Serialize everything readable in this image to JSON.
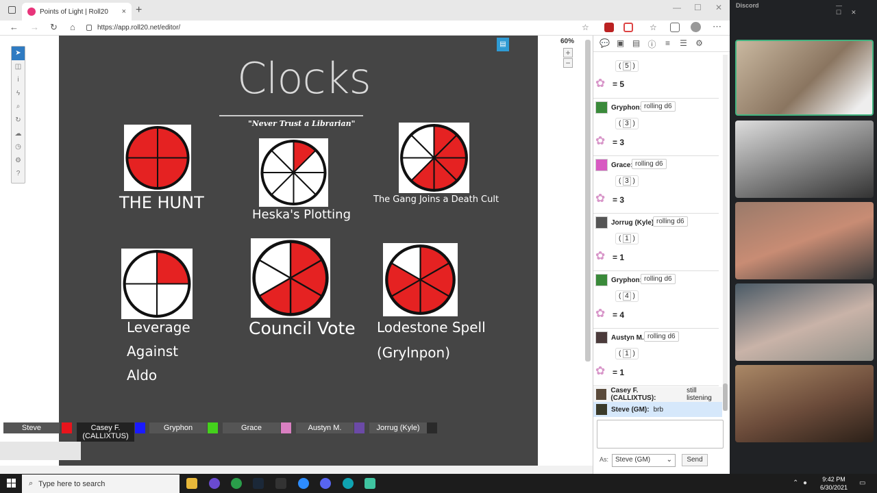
{
  "browser": {
    "tab_title": "Points of Light | Roll20",
    "url": "https://app.roll20.net/editor/",
    "new_tab": "+",
    "tab_close": "×"
  },
  "editor": {
    "zoom": "60%",
    "zoom_in": "+",
    "zoom_out": "−"
  },
  "board": {
    "title": "Clocks",
    "subtitle": "\"Never Trust a Librarian\"",
    "clocks": [
      {
        "label": "THE HUNT",
        "segments": 4,
        "filled": 4
      },
      {
        "label": "Heska's Plotting",
        "segments": 8,
        "filled": 1
      },
      {
        "label": "The Gang Joins a Death Cult",
        "segments": 8,
        "filled": 5
      },
      {
        "label": "Leverage Against Aldo",
        "segments": 4,
        "filled": 1
      },
      {
        "label": "Council Vote",
        "segments": 6,
        "filled": 4
      },
      {
        "label": "Lodestone Spell (Grylnpon)",
        "segments": 6,
        "filled": 5
      }
    ],
    "leverage_lines": [
      "Leverage",
      "Against",
      "Aldo"
    ],
    "lodestone_lines": [
      "Lodestone Spell",
      "(Grylnpon)"
    ]
  },
  "players": [
    {
      "name": "Steve",
      "color": "#e8141c"
    },
    {
      "name": "Casey F. (CALLIXTUS)",
      "color": "#1a1aff"
    },
    {
      "name": "Gryphon",
      "color": "#44d11c"
    },
    {
      "name": "Grace",
      "color": "#d97fc1"
    },
    {
      "name": "Austyn M.",
      "color": "#6b4aa6"
    },
    {
      "name": "Jorrug (Kyle)",
      "color": "#2a2a2a"
    }
  ],
  "chat": {
    "top_roll": {
      "die": "5",
      "result": "= 5"
    },
    "rolls": [
      {
        "who": "Gryphon:",
        "action": "rolling d6",
        "die": "3",
        "result": "= 3",
        "avatar_color": "#3a8a3a"
      },
      {
        "who": "Grace:",
        "action": "rolling d6",
        "die": "3",
        "result": "= 3",
        "avatar_color": "#d85ac2"
      },
      {
        "who": "Jorrug (Kyle):",
        "action": "rolling d6",
        "die": "1",
        "result": "= 1",
        "avatar_color": "#555"
      },
      {
        "who": "Gryphon:",
        "action": "rolling d6",
        "die": "4",
        "result": "= 4",
        "avatar_color": "#3a8a3a"
      },
      {
        "who": "Austyn M.:",
        "action": "rolling d6",
        "die": "1",
        "result": "= 1",
        "avatar_color": "#4b3b3b"
      }
    ],
    "messages": [
      {
        "who": "Casey F. (CALLIXTUS):",
        "text": "still listening",
        "highlight": false
      },
      {
        "who": "Steve (GM):",
        "text": "brb",
        "highlight": true
      }
    ],
    "as_label": "As:",
    "as_value": "Steve (GM)",
    "send_label": "Send"
  },
  "discord": {
    "title": "Discord"
  },
  "taskbar": {
    "search_placeholder": "Type here to search",
    "time": "9:42 PM",
    "date": "6/30/2021"
  }
}
